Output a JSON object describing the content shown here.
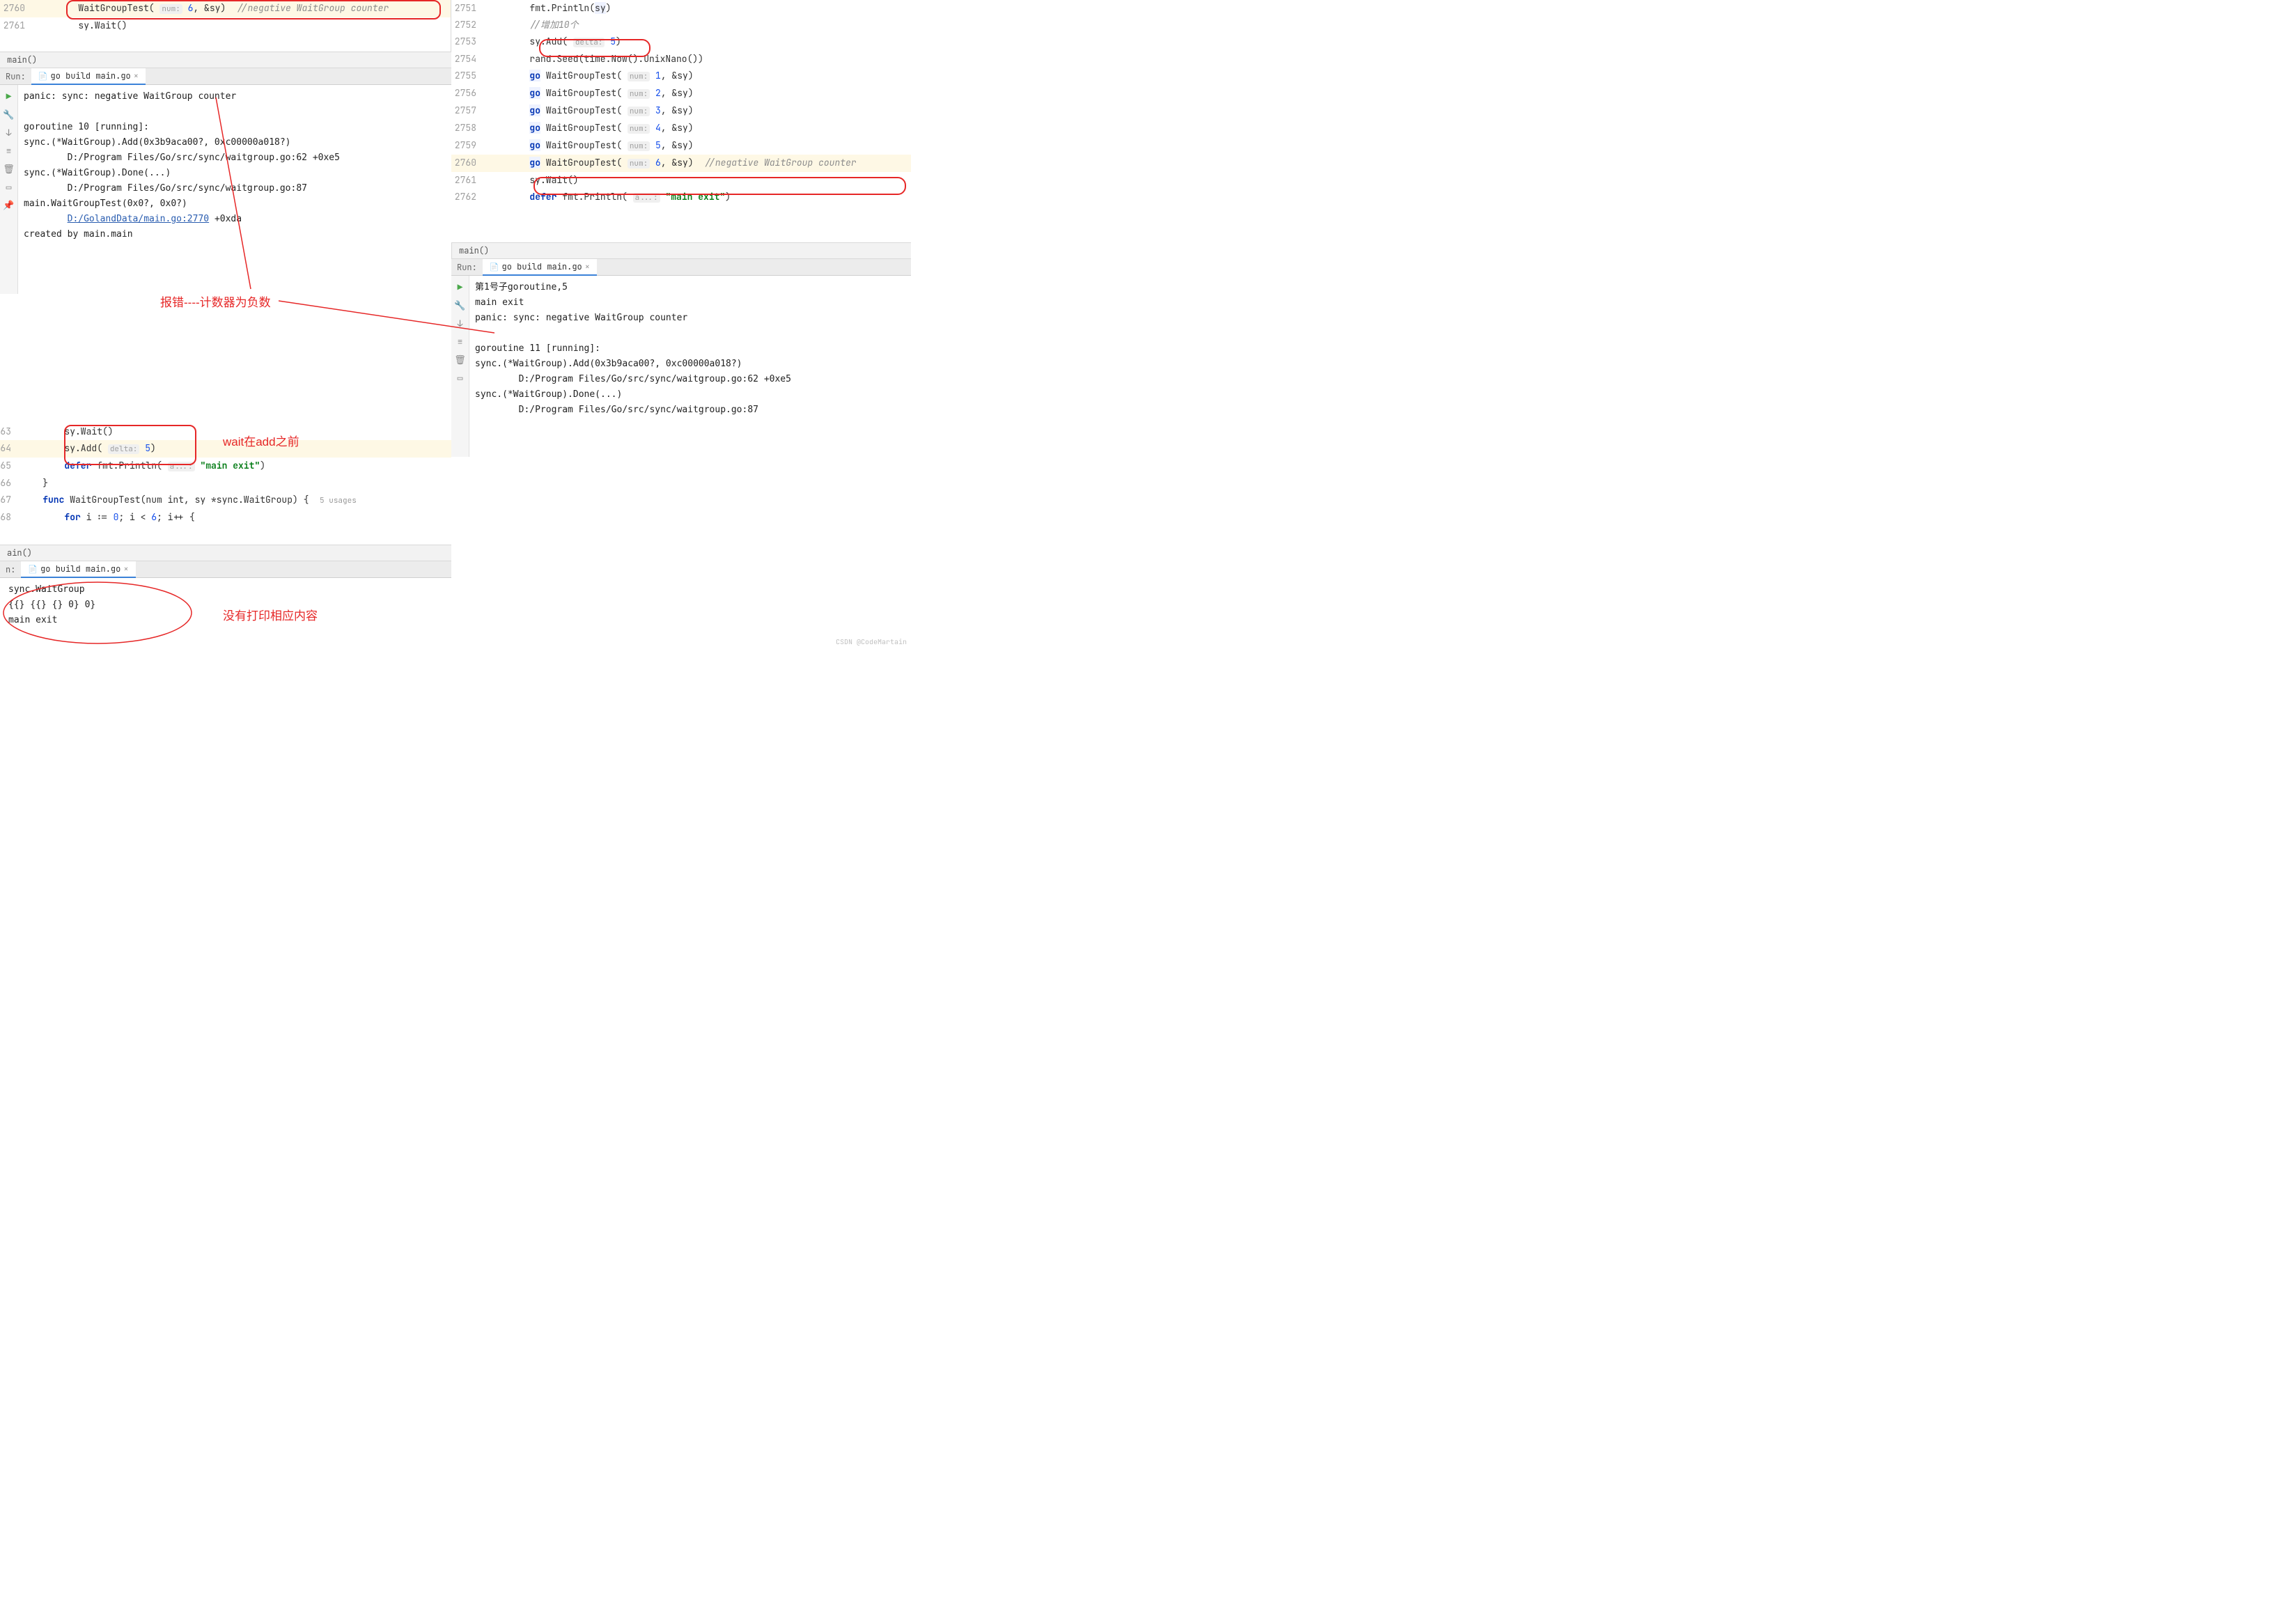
{
  "left": {
    "top_code": {
      "lines": [
        {
          "num": "2760",
          "indent": "        ",
          "tokens": [
            {
              "t": "WaitGroupTest( "
            },
            {
              "t": "num:",
              "cls": "hint"
            },
            {
              "t": " "
            },
            {
              "t": "6",
              "cls": "num"
            },
            {
              "t": ", &sy)  "
            },
            {
              "t": "//negative WaitGroup counter",
              "cls": "cmt"
            }
          ],
          "hl": true
        },
        {
          "num": "2761",
          "indent": "        ",
          "tokens": [
            {
              "t": "sy.Wait()"
            }
          ]
        },
        {
          "num": "",
          "indent": "        ",
          "tokens": []
        }
      ]
    },
    "crumb1": "main()",
    "run1": {
      "label": "Run:",
      "tab": "go build main.go",
      "output": [
        {
          "t": "panic: sync: negative WaitGroup counter"
        },
        {
          "t": ""
        },
        {
          "t": "goroutine 10 [running]:"
        },
        {
          "t": "sync.(*WaitGroup).Add(0x3b9aca00?, 0xc00000a018?)"
        },
        {
          "t": "        D:/Program Files/Go/src/sync/waitgroup.go:62 +0xe5"
        },
        {
          "t": "sync.(*WaitGroup).Done(...)"
        },
        {
          "t": "        D:/Program Files/Go/src/sync/waitgroup.go:87"
        },
        {
          "t": "main.WaitGroupTest(0x0?, 0x0?)"
        },
        {
          "t": "        ",
          "link": "D:/GolandData/main.go:2770",
          "after": " +0xda"
        },
        {
          "t": "created by main.main"
        }
      ]
    },
    "mid_code": {
      "lines": [
        {
          "num": "63",
          "indent": "        ",
          "tokens": [
            {
              "t": "sy.Wait()"
            }
          ]
        },
        {
          "num": "64",
          "indent": "        ",
          "tokens": [
            {
              "t": "sy.Add( "
            },
            {
              "t": "delta:",
              "cls": "hint"
            },
            {
              "t": " "
            },
            {
              "t": "5",
              "cls": "num"
            },
            {
              "t": ")"
            }
          ],
          "hl": true
        },
        {
          "num": "65",
          "indent": "        ",
          "tokens": [
            {
              "t": "defer",
              "cls": "kw"
            },
            {
              "t": " fmt.Println( "
            },
            {
              "t": "a...:",
              "cls": "hint"
            },
            {
              "t": " "
            },
            {
              "t": "\"main exit\"",
              "cls": "str"
            },
            {
              "t": ")"
            }
          ]
        },
        {
          "num": "66",
          "indent": "    ",
          "tokens": [
            {
              "t": "}"
            }
          ]
        },
        {
          "num": "67",
          "indent": "    ",
          "tokens": [
            {
              "t": "func",
              "cls": "kw"
            },
            {
              "t": " WaitGroupTest(num int, sy *sync.WaitGroup) {  "
            },
            {
              "t": "5 usages",
              "cls": "usages"
            }
          ]
        },
        {
          "num": "68",
          "indent": "        ",
          "tokens": [
            {
              "t": "for",
              "cls": "kw"
            },
            {
              "t": " i := "
            },
            {
              "t": "0",
              "cls": "num"
            },
            {
              "t": "; i < "
            },
            {
              "t": "6",
              "cls": "num"
            },
            {
              "t": "; i++ {"
            }
          ]
        }
      ]
    },
    "crumb2": "ain()",
    "run2": {
      "label": "n:",
      "tab": "go build main.go",
      "output": [
        {
          "t": "sync.WaitGroup"
        },
        {
          "t": "{{} {{} {} 0} 0}"
        },
        {
          "t": "main exit"
        }
      ]
    }
  },
  "right": {
    "code": {
      "lines": [
        {
          "num": "2751",
          "indent": "        ",
          "tokens": [
            {
              "t": "fmt.Println("
            },
            {
              "t": "sy",
              "bg": true
            },
            {
              "t": ")"
            }
          ]
        },
        {
          "num": "2752",
          "indent": "        ",
          "tokens": [
            {
              "t": "//增加10个",
              "cls": "cmt"
            }
          ]
        },
        {
          "num": "2753",
          "indent": "        ",
          "tokens": [
            {
              "t": "sy.Add( "
            },
            {
              "t": "delta:",
              "cls": "hint"
            },
            {
              "t": " "
            },
            {
              "t": "5",
              "cls": "num"
            },
            {
              "t": ")"
            }
          ]
        },
        {
          "num": "2754",
          "indent": "        ",
          "tokens": [
            {
              "t": "rand.Seed(time.Now().UnixNano())"
            }
          ]
        },
        {
          "num": "2755",
          "indent": "        ",
          "tokens": [
            {
              "t": "go",
              "cls": "kw",
              "bg": true
            },
            {
              "t": " WaitGroupTest( "
            },
            {
              "t": "num:",
              "cls": "hint"
            },
            {
              "t": " "
            },
            {
              "t": "1",
              "cls": "num"
            },
            {
              "t": ", &sy)"
            }
          ]
        },
        {
          "num": "2756",
          "indent": "        ",
          "tokens": [
            {
              "t": "go",
              "cls": "kw",
              "bg": true
            },
            {
              "t": " WaitGroupTest( "
            },
            {
              "t": "num:",
              "cls": "hint"
            },
            {
              "t": " "
            },
            {
              "t": "2",
              "cls": "num"
            },
            {
              "t": ", &sy)"
            }
          ]
        },
        {
          "num": "2757",
          "indent": "        ",
          "tokens": [
            {
              "t": "go",
              "cls": "kw",
              "bg": true
            },
            {
              "t": " WaitGroupTest( "
            },
            {
              "t": "num:",
              "cls": "hint"
            },
            {
              "t": " "
            },
            {
              "t": "3",
              "cls": "num"
            },
            {
              "t": ", &sy)"
            }
          ]
        },
        {
          "num": "2758",
          "indent": "        ",
          "tokens": [
            {
              "t": "go",
              "cls": "kw",
              "bg": true
            },
            {
              "t": " WaitGroupTest( "
            },
            {
              "t": "num:",
              "cls": "hint"
            },
            {
              "t": " "
            },
            {
              "t": "4",
              "cls": "num"
            },
            {
              "t": ", &sy)"
            }
          ]
        },
        {
          "num": "2759",
          "indent": "        ",
          "tokens": [
            {
              "t": "go",
              "cls": "kw",
              "bg": true
            },
            {
              "t": " WaitGroupTest( "
            },
            {
              "t": "num:",
              "cls": "hint"
            },
            {
              "t": " "
            },
            {
              "t": "5",
              "cls": "num"
            },
            {
              "t": ", &sy)"
            }
          ]
        },
        {
          "num": "2760",
          "indent": "        ",
          "tokens": [
            {
              "t": "go",
              "cls": "kw",
              "bg": true
            },
            {
              "t": " WaitGroupTest( "
            },
            {
              "t": "num:",
              "cls": "hint"
            },
            {
              "t": " "
            },
            {
              "t": "6",
              "cls": "num"
            },
            {
              "t": ", &sy)  "
            },
            {
              "t": "//negative WaitGroup counter",
              "cls": "cmt"
            }
          ],
          "hl": true
        },
        {
          "num": "2761",
          "indent": "        ",
          "tokens": [
            {
              "t": "sy.Wait()"
            }
          ]
        },
        {
          "num": "2762",
          "indent": "        ",
          "tokens": [
            {
              "t": "defer",
              "cls": "kw"
            },
            {
              "t": " fmt.Println( "
            },
            {
              "t": "a...:",
              "cls": "hint"
            },
            {
              "t": " "
            },
            {
              "t": "\"main exit\"",
              "cls": "str"
            },
            {
              "t": ")"
            }
          ]
        }
      ]
    },
    "crumb": "main()",
    "run": {
      "label": "Run:",
      "tab": "go build main.go",
      "output": [
        {
          "t": "第1号子goroutine,5"
        },
        {
          "t": "main exit"
        },
        {
          "t": "panic: sync: negative WaitGroup counter"
        },
        {
          "t": ""
        },
        {
          "t": "goroutine 11 [running]:"
        },
        {
          "t": "sync.(*WaitGroup).Add(0x3b9aca00?, 0xc00000a018?)"
        },
        {
          "t": "        D:/Program Files/Go/src/sync/waitgroup.go:62 +0xe5"
        },
        {
          "t": "sync.(*WaitGroup).Done(...)"
        },
        {
          "t": "        D:/Program Files/Go/src/sync/waitgroup.go:87"
        }
      ]
    }
  },
  "annotations": {
    "a1": "报错----计数器为负数",
    "a2": "wait在add之前",
    "a3": "没有打印相应内容"
  },
  "watermark": "CSDN @CodeMartain"
}
